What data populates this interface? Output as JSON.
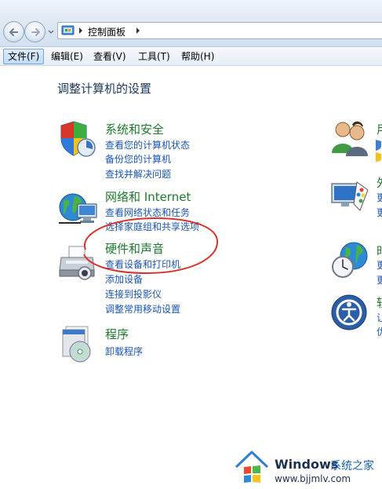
{
  "address_bar": {
    "breadcrumb": "控制面板"
  },
  "menu": {
    "items": [
      {
        "label": "文件(F)",
        "active": true
      },
      {
        "label": "编辑(E)",
        "active": false
      },
      {
        "label": "查看(V)",
        "active": false
      },
      {
        "label": "工具(T)",
        "active": false
      },
      {
        "label": "帮助(H)",
        "active": false
      }
    ]
  },
  "page": {
    "title": "调整计算机的设置"
  },
  "categories": [
    {
      "title": "系统和安全",
      "icon": "shield-icon",
      "links": [
        "查看您的计算机状态",
        "备份您的计算机",
        "查找并解决问题"
      ]
    },
    {
      "title": "网络和 Internet",
      "icon": "network-globe-icon",
      "links": [
        "查看网络状态和任务",
        "选择家庭组和共享选项"
      ]
    },
    {
      "title": "硬件和声音",
      "icon": "printer-icon",
      "links": [
        "查看设备和打印机",
        "添加设备",
        "连接到投影仪",
        "调整常用移动设置"
      ]
    },
    {
      "title": "程序",
      "icon": "program-disc-icon",
      "links": [
        "卸载程序"
      ]
    }
  ],
  "right_column": [
    {
      "title": "用",
      "icon": "user-accounts-icon",
      "links": [
        "",
        ""
      ]
    },
    {
      "title": "外",
      "icon": "appearance-monitor-icon",
      "links": [
        "更",
        "更"
      ]
    },
    {
      "title": "时",
      "icon": "clock-globe-icon",
      "links": [
        "更",
        "更"
      ]
    },
    {
      "title": "轻",
      "icon": "ease-of-access-icon",
      "links": [
        "让",
        "优"
      ]
    }
  ],
  "watermark": {
    "brand": "Windows",
    "subtitle": "系统之家",
    "url": "www.bjjmlv.com"
  },
  "colors": {
    "category_title": "#1e7a2b",
    "link": "#1a56b5",
    "annotation_circle": "#d9322b"
  }
}
